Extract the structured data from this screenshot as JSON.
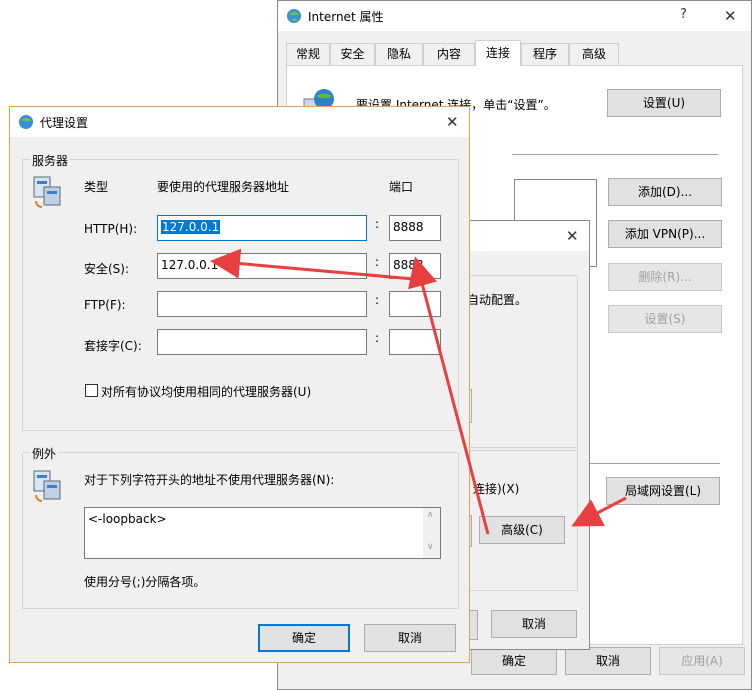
{
  "ie_window": {
    "title": "Internet 属性",
    "help": "?",
    "close": "✕",
    "tabs": [
      "常规",
      "安全",
      "隐私",
      "内容",
      "连接",
      "程序",
      "高级"
    ],
    "setup_text": "要设置 Internet 连接，单击“设置”。",
    "setup_button": "设置(U)",
    "add_button": "添加(D)...",
    "add_vpn_button": "添加 VPN(P)...",
    "delete_button": "删除(R)...",
    "settings_button": "设置(S)",
    "lan_button": "局域网设置(L)",
    "ok_button": "确定",
    "cancel_button": "取消",
    "apply_button": "应用(A)"
  },
  "lan_dialog": {
    "close": "✕",
    "auto_config_fragment": "用自动配置。",
    "dialup_fragment": "连接)(X)",
    "advanced_button": "高级(C)",
    "cancel_button": "取消"
  },
  "proxy_dialog": {
    "title": "代理设置",
    "close": "✕",
    "servers_group": "服务器",
    "col_type": "类型",
    "col_address": "要使用的代理服务器地址",
    "col_port": "端口",
    "rows": [
      {
        "label": "HTTP(H):",
        "address": "127.0.0.1",
        "port": "8888"
      },
      {
        "label": "安全(S):",
        "address": "127.0.0.1",
        "port": "8888"
      },
      {
        "label": "FTP(F):",
        "address": "",
        "port": ""
      },
      {
        "label": "套接字(C):",
        "address": "",
        "port": ""
      }
    ],
    "colon": ":",
    "same_proxy_checkbox": "对所有协议均使用相同的代理服务器(U)",
    "exceptions_group": "例外",
    "exceptions_desc": "对于下列字符开头的地址不使用代理服务器(N):",
    "exceptions_value": "<-loopback>",
    "exceptions_hint": "使用分号(;)分隔各项。",
    "ok_button": "确定",
    "cancel_button": "取消"
  },
  "colors": {
    "accent": "#0078d7",
    "dialog_border": "#e8a060",
    "annotation_arrow": "#e84040"
  }
}
